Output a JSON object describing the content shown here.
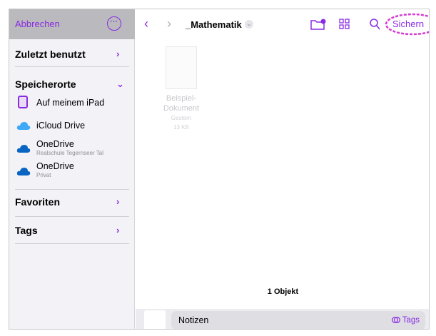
{
  "sidebar": {
    "cancel_label": "Abbrechen",
    "recents_label": "Zuletzt benutzt",
    "locations_label": "Speicherorte",
    "locations": [
      {
        "label": "Auf meinem iPad",
        "sub": "",
        "icon": "ipad-icon"
      },
      {
        "label": "iCloud Drive",
        "sub": "",
        "icon": "icloud-icon"
      },
      {
        "label": "OneDrive",
        "sub": "Realschule Tegernseer Tal",
        "icon": "onedrive-icon"
      },
      {
        "label": "OneDrive",
        "sub": "Privat",
        "icon": "onedrive-icon"
      }
    ],
    "favorites_label": "Favoriten",
    "tags_label": "Tags"
  },
  "header": {
    "folder_title": "_Mathematik",
    "save_label": "Sichern"
  },
  "content": {
    "file": {
      "name_line1": "Beispiel-",
      "name_line2": "Dokument",
      "date": "Gestern",
      "size": "13 KB"
    },
    "count_label": "1 Objekt"
  },
  "bottom": {
    "filename": "Notizen",
    "tags_label": "Tags"
  },
  "colors": {
    "accent": "#8a2be2",
    "highlight_marker": "#d63bd1",
    "sidebar_bg": "#f2f2f7"
  }
}
